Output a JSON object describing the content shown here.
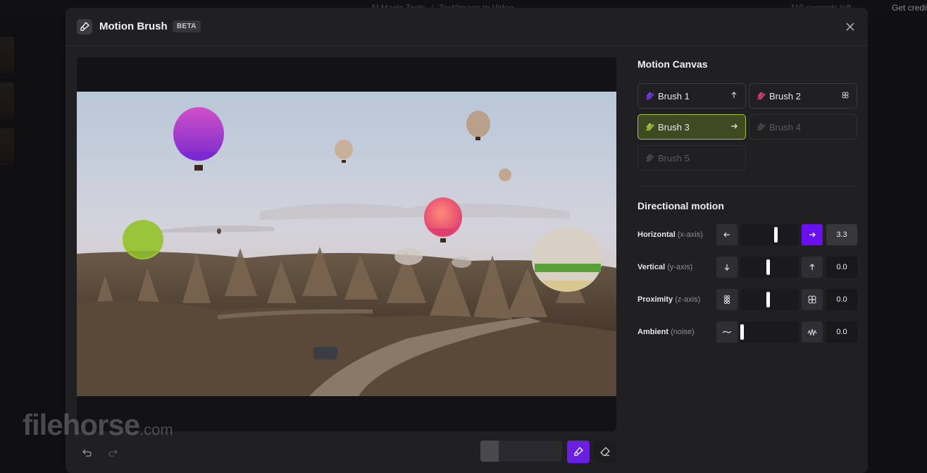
{
  "background": {
    "breadcrumb": [
      "AI Magic Tools",
      "Text/Image to Video"
    ],
    "credits": "110 seconds left",
    "get_credits": "Get credits"
  },
  "modal": {
    "title": "Motion Brush",
    "badge": "BETA"
  },
  "canvas": {
    "section_title": "Motion Canvas",
    "brushes": [
      {
        "label": "Brush 1",
        "color": "#7a3cf0",
        "direction": "arrow-up-icon",
        "state": "normal"
      },
      {
        "label": "Brush 2",
        "color": "#e0407a",
        "direction": "proximity-icon",
        "state": "normal"
      },
      {
        "label": "Brush 3",
        "color": "#a8c64a",
        "direction": "arrow-right-icon",
        "state": "selected"
      },
      {
        "label": "Brush 4",
        "color": "#5a5a60",
        "direction": "",
        "state": "disabled"
      },
      {
        "label": "Brush 5",
        "color": "#5a5a60",
        "direction": "",
        "state": "disabled"
      }
    ]
  },
  "motion": {
    "section_title": "Directional motion",
    "rows": [
      {
        "label": "Horizontal",
        "axis": "(x-axis)",
        "value": "3.3",
        "level": 0.62,
        "left_icon": "arrow-left-icon",
        "right_icon": "arrow-right-icon",
        "right_active": true
      },
      {
        "label": "Vertical",
        "axis": "(y-axis)",
        "value": "0.0",
        "level": 0.47,
        "left_icon": "arrow-down-icon",
        "right_icon": "arrow-up-icon",
        "right_active": false
      },
      {
        "label": "Proximity",
        "axis": "(z-axis)",
        "value": "0.0",
        "level": 0.47,
        "left_icon": "dots-small-icon",
        "right_icon": "dots-large-icon",
        "right_active": false
      },
      {
        "label": "Ambient",
        "axis": "(noise)",
        "value": "0.0",
        "level": 0.0,
        "left_icon": "wave-low-icon",
        "right_icon": "wave-high-icon",
        "right_active": false
      }
    ]
  },
  "toolbar": {
    "brush_size_level": 0.22,
    "active_tool": "brush"
  },
  "colors": {
    "accent": "#6a10f0",
    "selected_brush": "#a8c64a"
  },
  "watermark": {
    "name": "filehorse",
    "domain": ".com"
  }
}
